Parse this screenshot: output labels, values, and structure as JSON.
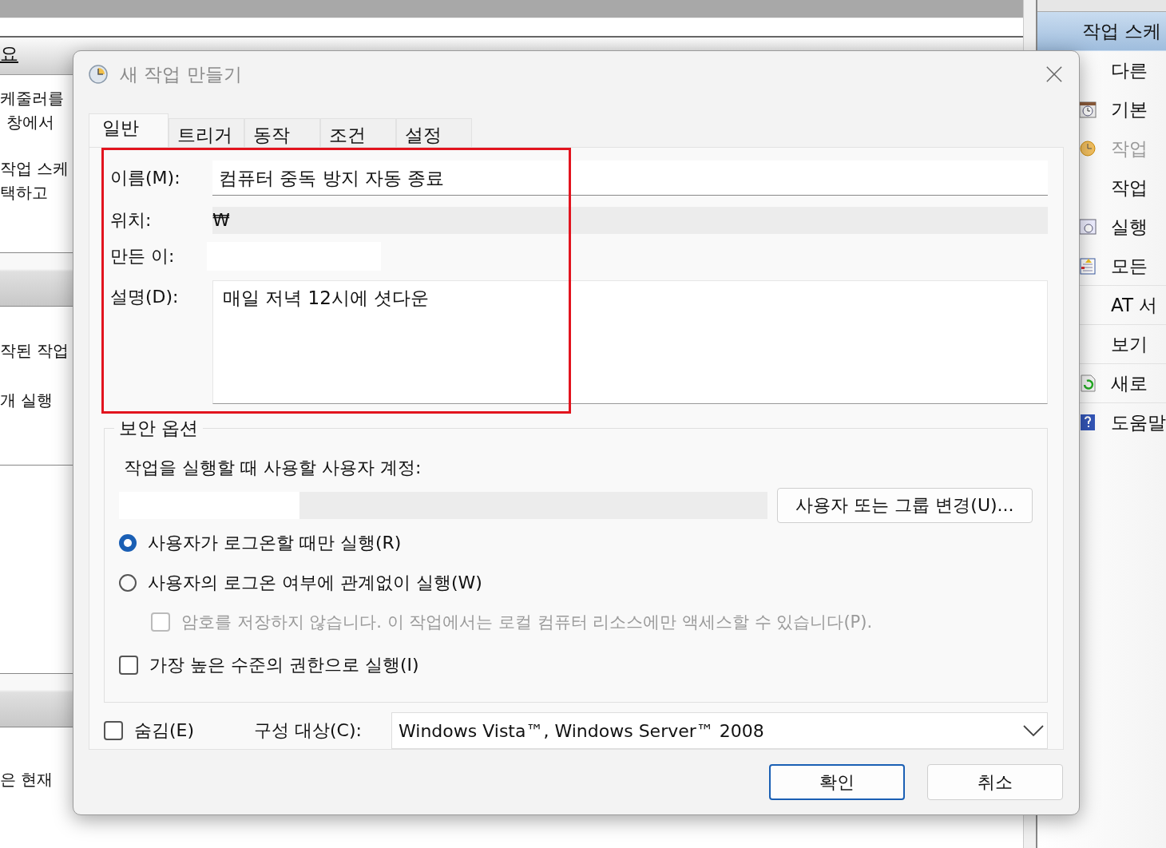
{
  "background": {
    "left_items": [
      {
        "kind": "header",
        "text": "요"
      },
      {
        "kind": "text",
        "text": "케줄러를"
      },
      {
        "kind": "text",
        "text": "창에서"
      },
      {
        "kind": "text",
        "text": "작업 스케"
      },
      {
        "kind": "text",
        "text": "택하고"
      },
      {
        "kind": "bar"
      },
      {
        "kind": "text",
        "text": "작된 작업"
      },
      {
        "kind": "text",
        "text": "개 실행"
      },
      {
        "kind": "blank"
      },
      {
        "kind": "bar"
      },
      {
        "kind": "text",
        "text": "은 현재"
      }
    ],
    "actions": [
      {
        "label": "작업 스케",
        "selected": true,
        "disabled": false
      },
      {
        "label": "다른",
        "selected": false,
        "disabled": false
      },
      {
        "label": "기본",
        "selected": false,
        "disabled": false
      },
      {
        "label": "작업",
        "selected": false,
        "disabled": true
      },
      {
        "label": "작업",
        "selected": false,
        "disabled": false
      },
      {
        "label": "실행",
        "selected": false,
        "disabled": false
      },
      {
        "label": "모든",
        "selected": false,
        "disabled": false
      },
      {
        "label": "AT 서",
        "selected": false,
        "disabled": false
      },
      {
        "label": "보기",
        "selected": false,
        "disabled": false
      },
      {
        "label": "새로",
        "selected": false,
        "disabled": false
      },
      {
        "label": "도움말",
        "selected": false,
        "disabled": false
      }
    ]
  },
  "dialog": {
    "title": "새 작업 만들기",
    "tabs": [
      {
        "label": "일반",
        "selected": true
      },
      {
        "label": "트리거",
        "selected": false
      },
      {
        "label": "동작",
        "selected": false
      },
      {
        "label": "조건",
        "selected": false
      },
      {
        "label": "설정",
        "selected": false
      }
    ],
    "general": {
      "highlighted": true,
      "name_label": "이름(M):",
      "name_value": "컴퓨터 중독 방지 자동 종료",
      "location_label": "위치:",
      "location_value": "₩",
      "author_label": "만든 이:",
      "description_label": "설명(D):",
      "description_value": "매일 저녁 12시에 셧다운"
    },
    "security": {
      "title": "보안 옵션",
      "account_label": "작업을 실행할 때 사용할 사용자 계정:",
      "change_button": "사용자 또는 그룹 변경(U)...",
      "options": [
        {
          "kind": "radio",
          "label": "사용자가 로그온할 때만 실행(R)",
          "selected": true,
          "disabled": false
        },
        {
          "kind": "radio",
          "label": "사용자의 로그온 여부에 관계없이 실행(W)",
          "selected": false,
          "disabled": false
        },
        {
          "kind": "subcheckbox",
          "label": "암호를 저장하지 않습니다. 이 작업에서는 로컬 컴퓨터 리소스에만 액세스할 수 있습니다(P).",
          "checked": false,
          "disabled": true
        },
        {
          "kind": "checkbox",
          "label": "가장 높은 수준의 권한으로 실행(I)",
          "checked": false,
          "disabled": false
        }
      ]
    },
    "hidden": {
      "label": "숨김(E)",
      "checked": false
    },
    "configure_label": "구성 대상(C):",
    "configure_value": "Windows Vista™, Windows Server™ 2008",
    "buttons": [
      {
        "label": "확인",
        "default": true
      },
      {
        "label": "취소",
        "default": false
      }
    ]
  }
}
